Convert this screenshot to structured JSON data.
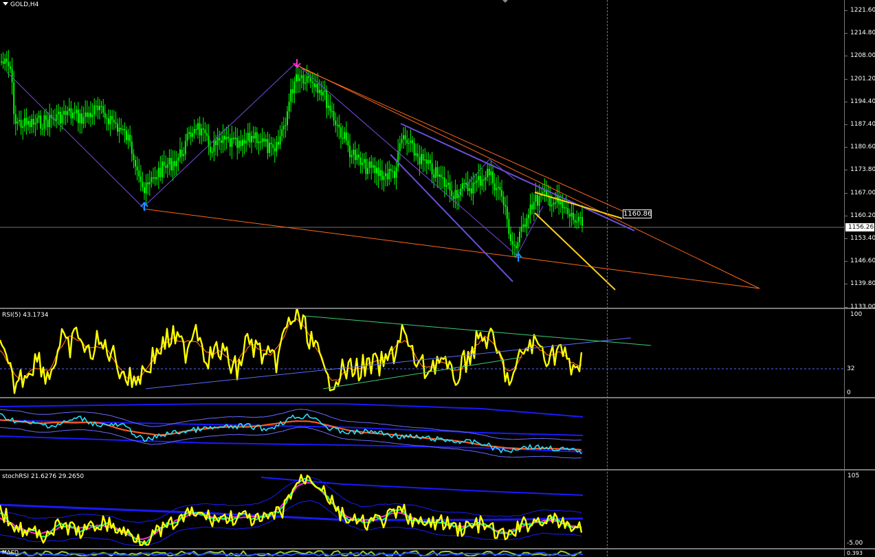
{
  "chart": {
    "symbol_title": "GOLD,H4",
    "current_price": "1156.26",
    "marker_price": "1160.86",
    "price_labels": [
      "1221.60",
      "1214.80",
      "1208.00",
      "1201.20",
      "1194.40",
      "1187.40",
      "1180.60",
      "1173.80",
      "1167.00",
      "1160.20",
      "1153.40",
      "1146.60",
      "1139.80",
      "1133.00"
    ],
    "colors": {
      "candle": "#00ff00",
      "background": "#000000",
      "orange": "#ff6a1a",
      "purple": "#6b4fd8",
      "violet": "#7a4be0",
      "yellow": "#ffd21a",
      "arrow_up": "#1e90ff",
      "arrow_down": "#ff2bd6"
    }
  },
  "rsi": {
    "title": "RSI(5) 43.1734",
    "levels": [
      "100",
      "32",
      "0"
    ],
    "colors": {
      "main": "#ffff00",
      "signal": "#ff6a1a",
      "trend_green": "#3ccf7a",
      "trend_blue": "#5a6bff"
    }
  },
  "bands": {
    "title": "",
    "colors": {
      "price": "#28e0ff",
      "ma": "#ff5a1a",
      "band": "#1a1aff",
      "envelope": "#6a6aff"
    }
  },
  "stochrsi": {
    "title": "stochRSI 21.6276 29.2650",
    "levels": [
      "105",
      "-5.00"
    ],
    "colors": {
      "k": "#ffff00",
      "d": "#00ff66",
      "signal": "#ff2bd6",
      "band": "#1a1aff"
    }
  },
  "macd": {
    "title": "MACD",
    "level": "0.393"
  }
}
